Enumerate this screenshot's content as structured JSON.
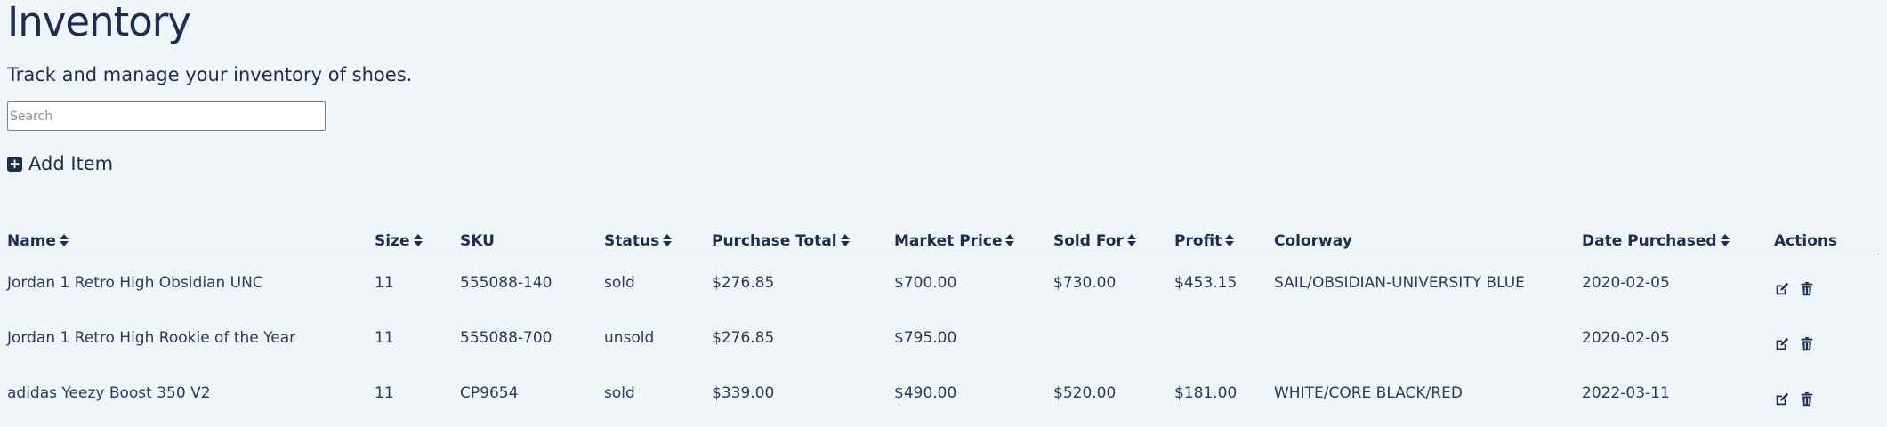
{
  "header": {
    "title": "Inventory",
    "subtitle": "Track and manage your inventory of shoes."
  },
  "search": {
    "placeholder": "Search",
    "value": ""
  },
  "toolbar": {
    "add_item_label": "Add Item",
    "add_item_icon": "plus-square-icon"
  },
  "table": {
    "columns": [
      {
        "label": "Name",
        "sortable": true
      },
      {
        "label": "Size",
        "sortable": true
      },
      {
        "label": "SKU",
        "sortable": false
      },
      {
        "label": "Status",
        "sortable": true
      },
      {
        "label": "Purchase Total",
        "sortable": true
      },
      {
        "label": "Market Price",
        "sortable": true
      },
      {
        "label": "Sold For",
        "sortable": true
      },
      {
        "label": "Profit",
        "sortable": true
      },
      {
        "label": "Colorway",
        "sortable": false
      },
      {
        "label": "Date Purchased",
        "sortable": true
      },
      {
        "label": "Actions",
        "sortable": false
      }
    ],
    "rows": [
      {
        "name": "Jordan 1 Retro High Obsidian UNC",
        "size": "11",
        "sku": "555088-140",
        "status": "sold",
        "purchase_total": "$276.85",
        "market_price": "$700.00",
        "sold_for": "$730.00",
        "profit": "$453.15",
        "colorway": "SAIL/OBSIDIAN-UNIVERSITY BLUE",
        "date_purchased": "2020-02-05"
      },
      {
        "name": "Jordan 1 Retro High Rookie of the Year",
        "size": "11",
        "sku": "555088-700",
        "status": "unsold",
        "purchase_total": "$276.85",
        "market_price": "$795.00",
        "sold_for": "",
        "profit": "",
        "colorway": "",
        "date_purchased": "2020-02-05"
      },
      {
        "name": "adidas Yeezy Boost 350 V2",
        "size": "11",
        "sku": "CP9654",
        "status": "sold",
        "purchase_total": "$339.00",
        "market_price": "$490.00",
        "sold_for": "$520.00",
        "profit": "$181.00",
        "colorway": "WHITE/CORE BLACK/RED",
        "date_purchased": "2022-03-11"
      }
    ],
    "action_icons": [
      "edit-icon",
      "trash-icon"
    ]
  },
  "colors": {
    "background": "#f0f5fa",
    "primary": "#1c2d4f",
    "text": "#2a3a5c"
  }
}
